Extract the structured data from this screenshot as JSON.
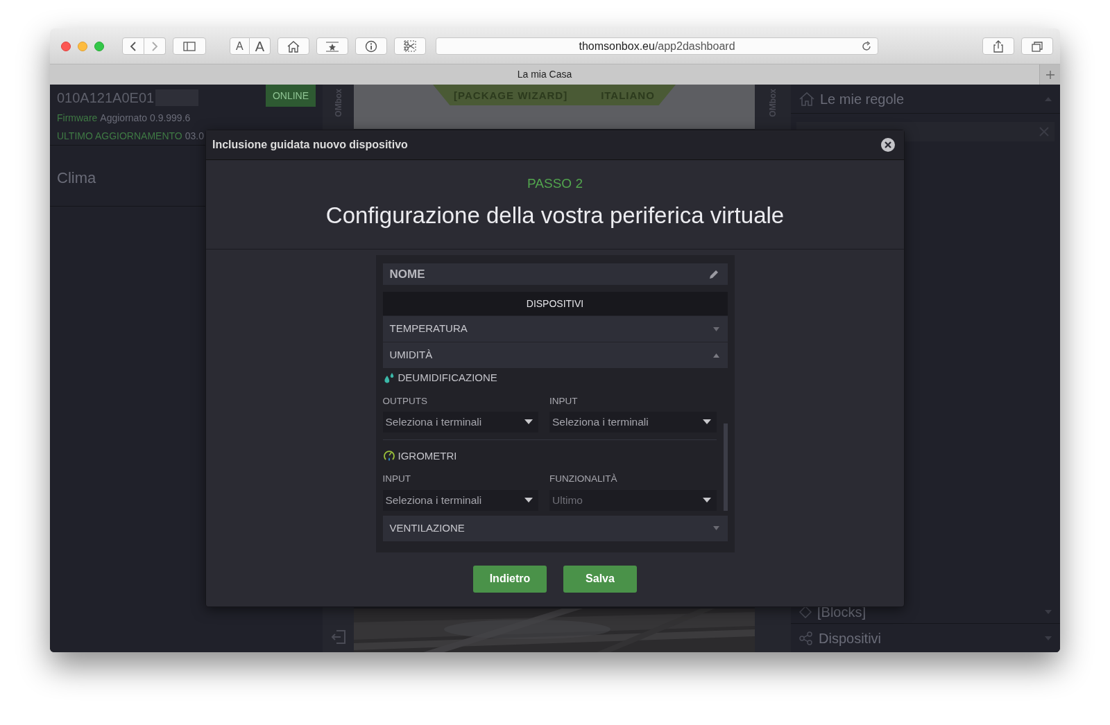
{
  "browser": {
    "url_host": "thomsonbox.eu",
    "url_path": "/app2dashboard",
    "font_buttons": [
      "A",
      "A"
    ],
    "tab_title": "La mia Casa"
  },
  "left_panel": {
    "device_id": "010A121A0E01",
    "status": "ONLINE",
    "firmware_label": "Firmware",
    "firmware_value": "Aggiornato 0.9.999.6",
    "update_label": "ULTIMO AGGIORNAMENTO",
    "update_value": "03.0",
    "section": "Clima"
  },
  "strips": [
    "OMbox",
    "OMbox"
  ],
  "banner": [
    "[PACKAGE WIZARD]",
    "ITALIANO"
  ],
  "right_panel": {
    "title": "Le mie regole",
    "items": [
      {
        "label": "[Blocks]",
        "kind": "blocks"
      },
      {
        "label": "Dispositivi",
        "kind": "devices"
      }
    ]
  },
  "modal": {
    "title": "Inclusione guidata nuovo dispositivo",
    "step": "PASSO 2",
    "heading": "Configurazione della vostra periferica virtuale",
    "name_label": "NOME",
    "tab": "DISPOSITIVI",
    "groups": [
      {
        "label": "TEMPERATURA",
        "expanded": false
      },
      {
        "label": "UMIDITÀ",
        "expanded": true,
        "sections": [
          {
            "title": "DEUMIDIFICAZIONE",
            "kind": "drops",
            "fields": [
              {
                "label": "OUTPUTS",
                "value": "Seleziona i terminali",
                "disabled": false
              },
              {
                "label": "INPUT",
                "value": "Seleziona i terminali",
                "disabled": false
              }
            ]
          },
          {
            "title": "IGROMETRI",
            "kind": "gauge",
            "fields": [
              {
                "label": "INPUT",
                "value": "Seleziona i terminali",
                "disabled": false
              },
              {
                "label": "FUNZIONALITÀ",
                "value": "Ultimo",
                "disabled": true
              }
            ]
          }
        ]
      },
      {
        "label": "VENTILAZIONE",
        "expanded": false
      }
    ],
    "buttons": [
      "Indietro",
      "Salva"
    ]
  }
}
